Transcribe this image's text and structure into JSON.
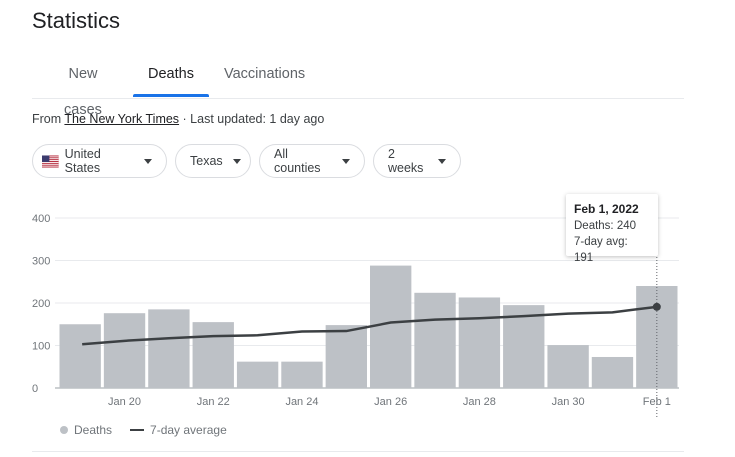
{
  "page": {
    "title": "Statistics"
  },
  "tabs": [
    {
      "label": "New cases",
      "active": false
    },
    {
      "label": "Deaths",
      "active": true
    },
    {
      "label": "Vaccinations",
      "active": false
    }
  ],
  "source": {
    "prefix": "From",
    "link_text": "The New York Times",
    "updated": "· Last updated: 1 day ago"
  },
  "filters": [
    {
      "label": "United States",
      "icon": "us-flag-icon"
    },
    {
      "label": "Texas"
    },
    {
      "label": "All counties"
    },
    {
      "label": "2 weeks"
    }
  ],
  "tooltip": {
    "date": "Feb 1, 2022",
    "deaths": "Deaths: 240",
    "avg": "7-day avg: 191"
  },
  "legend": {
    "deaths": "Deaths",
    "avg": "7-day average"
  },
  "colors": {
    "accent": "#1a73e8",
    "bar": "#bdc1c6",
    "line": "#3c4043"
  },
  "chart_data": {
    "type": "bar",
    "categories": [
      "Jan 19",
      "Jan 20",
      "Jan 21",
      "Jan 22",
      "Jan 23",
      "Jan 24",
      "Jan 25",
      "Jan 26",
      "Jan 27",
      "Jan 28",
      "Jan 29",
      "Jan 30",
      "Jan 31",
      "Feb 1"
    ],
    "x_tick_labels": [
      "Jan 20",
      "Jan 22",
      "Jan 24",
      "Jan 26",
      "Jan 28",
      "Jan 30",
      "Feb 1"
    ],
    "series": [
      {
        "name": "Deaths",
        "type": "bar",
        "values": [
          150,
          176,
          185,
          155,
          62,
          62,
          148,
          288,
          224,
          213,
          195,
          101,
          73,
          240
        ]
      },
      {
        "name": "7-day average",
        "type": "line",
        "values": [
          103,
          111,
          117,
          122,
          124,
          133,
          134,
          154,
          161,
          164,
          169,
          175,
          178,
          191
        ]
      }
    ],
    "yticks": [
      0,
      100,
      200,
      300,
      400
    ],
    "ylim": [
      0,
      400
    ],
    "grid": true,
    "legend_position": "bottom-left",
    "highlighted": "Feb 1"
  }
}
